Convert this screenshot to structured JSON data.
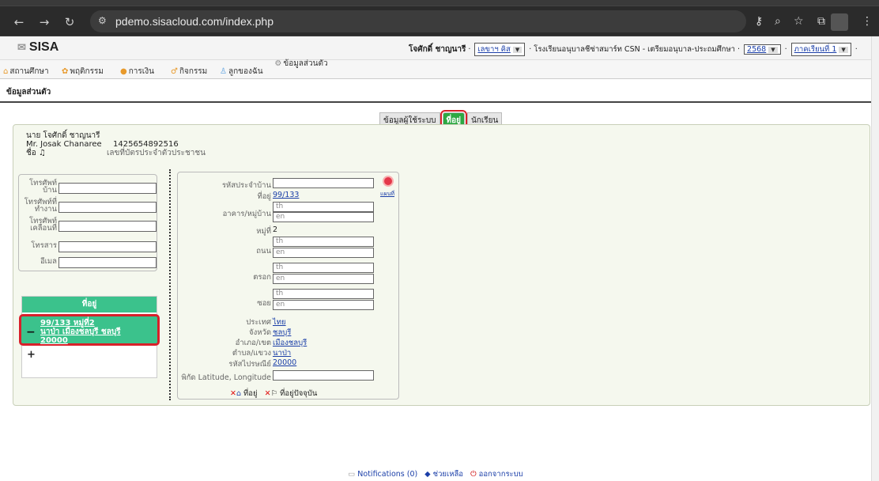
{
  "browser": {
    "url": "pdemo.sisacloud.com/index.php"
  },
  "app": {
    "logo": "SISA",
    "user_name": "โจศักดิ์ ชาญนารี",
    "role_select": "เลขาฯ คิส",
    "school": "โรงเรียนอนุบาลชีซ่าสมาร์ท CSN - เตรียมอนุบาล-ประถมศึกษา",
    "year_select": "2568",
    "term_select": "ภาคเรียนที่ 1"
  },
  "menu": {
    "items": [
      "สถานศึกษา",
      "พฤติกรรม",
      "การเงิน",
      "กิจกรรม",
      "ลูกของฉัน",
      "ข้อมูลส่วนตัว"
    ]
  },
  "breadcrumb": "ข้อมูลส่วนตัว",
  "tabs": [
    "ข้อมูลผู้ใช้ระบบ",
    "ที่อยู่",
    "นักเรียน"
  ],
  "person": {
    "name_th": "นาย โจศักดิ์ ชาญนารี",
    "name_en": "Mr. Josak Chanaree",
    "name_label": "ชื่อ",
    "id_number": "1425654892516",
    "id_label": "เลขที่บัตรประจำตัวประชาชน"
  },
  "contact": {
    "home_phone": "โทรศัพท์บ้าน",
    "work_phone": "โทรศัพท์ที่ทำงาน",
    "mobile": "โทรศัพท์เคลื่อนที่",
    "fax": "โทรสาร",
    "email": "อีเมล"
  },
  "address_list": {
    "header": "ที่อยู่",
    "entry_line1": "99/133 หมู่ที่2",
    "entry_line2": "นาป่า เมืองชลบุรี ชลบุรี",
    "entry_line3": "20000"
  },
  "address_form": {
    "house_code_label": "รหัสประจำบ้าน",
    "address_label": "ที่อยู่",
    "address_value": "99/133",
    "map_link": "แผนที่",
    "building_label": "อาคาร/หมู่บ้าน",
    "th_placeholder": "th",
    "en_placeholder": "en",
    "moo_label": "หมู่ที่",
    "moo_value": "2",
    "road_label": "ถนน",
    "alley_label": "ตรอก",
    "soi_label": "ซอย",
    "country_label": "ประเทศ",
    "country_value": "ไทย",
    "province_label": "จังหวัด",
    "province_value": "ชลบุรี",
    "district_label": "อำเภอ/เขต",
    "district_value": "เมืองชลบุรี",
    "subdistrict_label": "ตำบล/แขวง",
    "subdistrict_value": "นาป่า",
    "postal_label": "รหัสไปรษณีย์",
    "postal_value": "20000",
    "latlng_label": "พิกัด Latitude, Longitude",
    "action_address": "ที่อยู่",
    "action_current": "ที่อยู่ปัจจุบัน"
  },
  "footer": {
    "notifications": "Notifications (0)",
    "help": "ช่วยเหลือ",
    "logout": "ออกจากระบบ"
  }
}
